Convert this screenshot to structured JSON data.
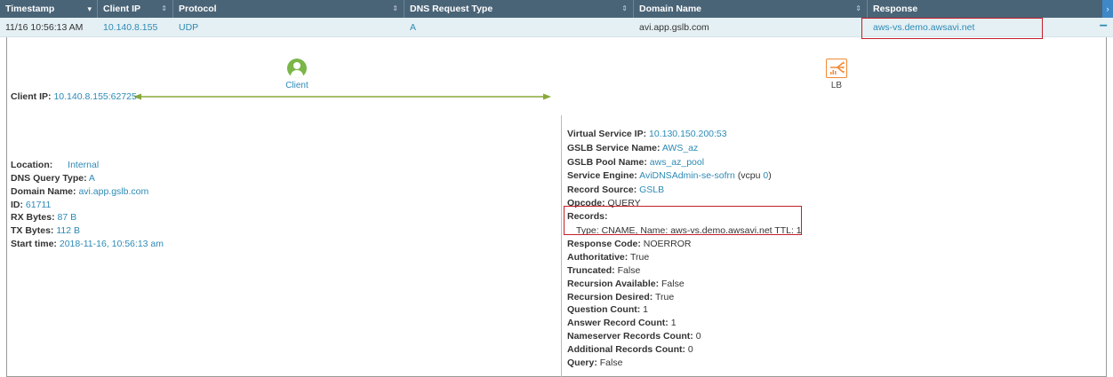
{
  "table": {
    "columns": [
      {
        "label": "Timestamp",
        "sort": "▾",
        "width": 110
      },
      {
        "label": "Client IP",
        "sort": "⇕",
        "width": 85
      },
      {
        "label": "Protocol",
        "sort": "⇕",
        "width": 260
      },
      {
        "label": "DNS Request Type",
        "sort": "⇕",
        "width": 258
      },
      {
        "label": "Domain Name",
        "sort": "⇕",
        "width": 263
      },
      {
        "label": "Response",
        "sort": "",
        "width": 264
      }
    ],
    "row": {
      "timestamp": "11/16 10:56:13 AM",
      "client_ip": "10.140.8.155",
      "protocol": "UDP",
      "dns_request_type": "A",
      "domain_name": "avi.app.gslb.com",
      "response": "aws-vs.demo.awsavi.net",
      "collapse_symbol": "−"
    }
  },
  "nodes": {
    "client_label": "Client",
    "lb_label": "LB"
  },
  "client": {
    "client_ip": {
      "k": "Client IP:",
      "v": "10.140.8.155:62725"
    },
    "location": {
      "k": "Location:",
      "v": "Internal"
    },
    "dns_query_type": {
      "k": "DNS Query Type:",
      "v": "A"
    },
    "domain_name": {
      "k": "Domain Name:",
      "v": "avi.app.gslb.com"
    },
    "id": {
      "k": "ID:",
      "v": "61711"
    },
    "rx_bytes": {
      "k": "RX Bytes:",
      "v": "87 B"
    },
    "tx_bytes": {
      "k": "TX Bytes:",
      "v": "112 B"
    },
    "start_time": {
      "k": "Start time:",
      "v": "2018-11-16, 10:56:13 am"
    }
  },
  "server": {
    "virtual_service_ip": {
      "k": "Virtual Service IP:",
      "v": "10.130.150.200:53"
    },
    "gslb_service_name": {
      "k": "GSLB Service Name:",
      "v": "AWS_az"
    },
    "gslb_pool_name": {
      "k": "GSLB Pool Name:",
      "v": "aws_az_pool"
    },
    "service_engine": {
      "k": "Service Engine:",
      "v": "AviDNSAdmin-se-sofrn",
      "extra_pre": "(vcpu ",
      "extra_val": "0",
      "extra_post": ")"
    },
    "record_source": {
      "k": "Record Source:",
      "v": "GSLB"
    },
    "opcode": {
      "k": "Opcode:",
      "v": "QUERY"
    },
    "records": {
      "k": "Records:",
      "v": ""
    },
    "records_type": "Type: CNAME, Name: aws-vs.demo.awsavi.net TTL: 1",
    "response_code": {
      "k": "Response Code:",
      "v": "NOERROR"
    },
    "authoritative": {
      "k": "Authoritative:",
      "v": "True"
    },
    "truncated": {
      "k": "Truncated:",
      "v": "False"
    },
    "recursion_available": {
      "k": "Recursion Available:",
      "v": "False"
    },
    "recursion_desired": {
      "k": "Recursion Desired:",
      "v": "True"
    },
    "question_count": {
      "k": "Question Count:",
      "v": "1"
    },
    "answer_record_count": {
      "k": "Answer Record Count:",
      "v": "1"
    },
    "nameserver_records_count": {
      "k": "Nameserver Records Count:",
      "v": "0"
    },
    "additional_records_count": {
      "k": "Additional Records Count:",
      "v": "0"
    },
    "query": {
      "k": "Query:",
      "v": "False"
    }
  },
  "colors": {
    "header_bg": "#4a6477",
    "row_bg": "#e5f0f4",
    "link": "#2c8ab5",
    "client_green": "#7ab648",
    "lb_orange": "#f08a35",
    "arrow_green": "#8aa83a",
    "highlight_red": "#c41e2a"
  },
  "icons": {
    "sort_desc": "sort-descending-icon",
    "sort_both": "sort-icon",
    "expand": "expand-columns-icon",
    "collapse": "collapse-icon",
    "client": "user-icon",
    "lb": "load-balancer-icon"
  }
}
